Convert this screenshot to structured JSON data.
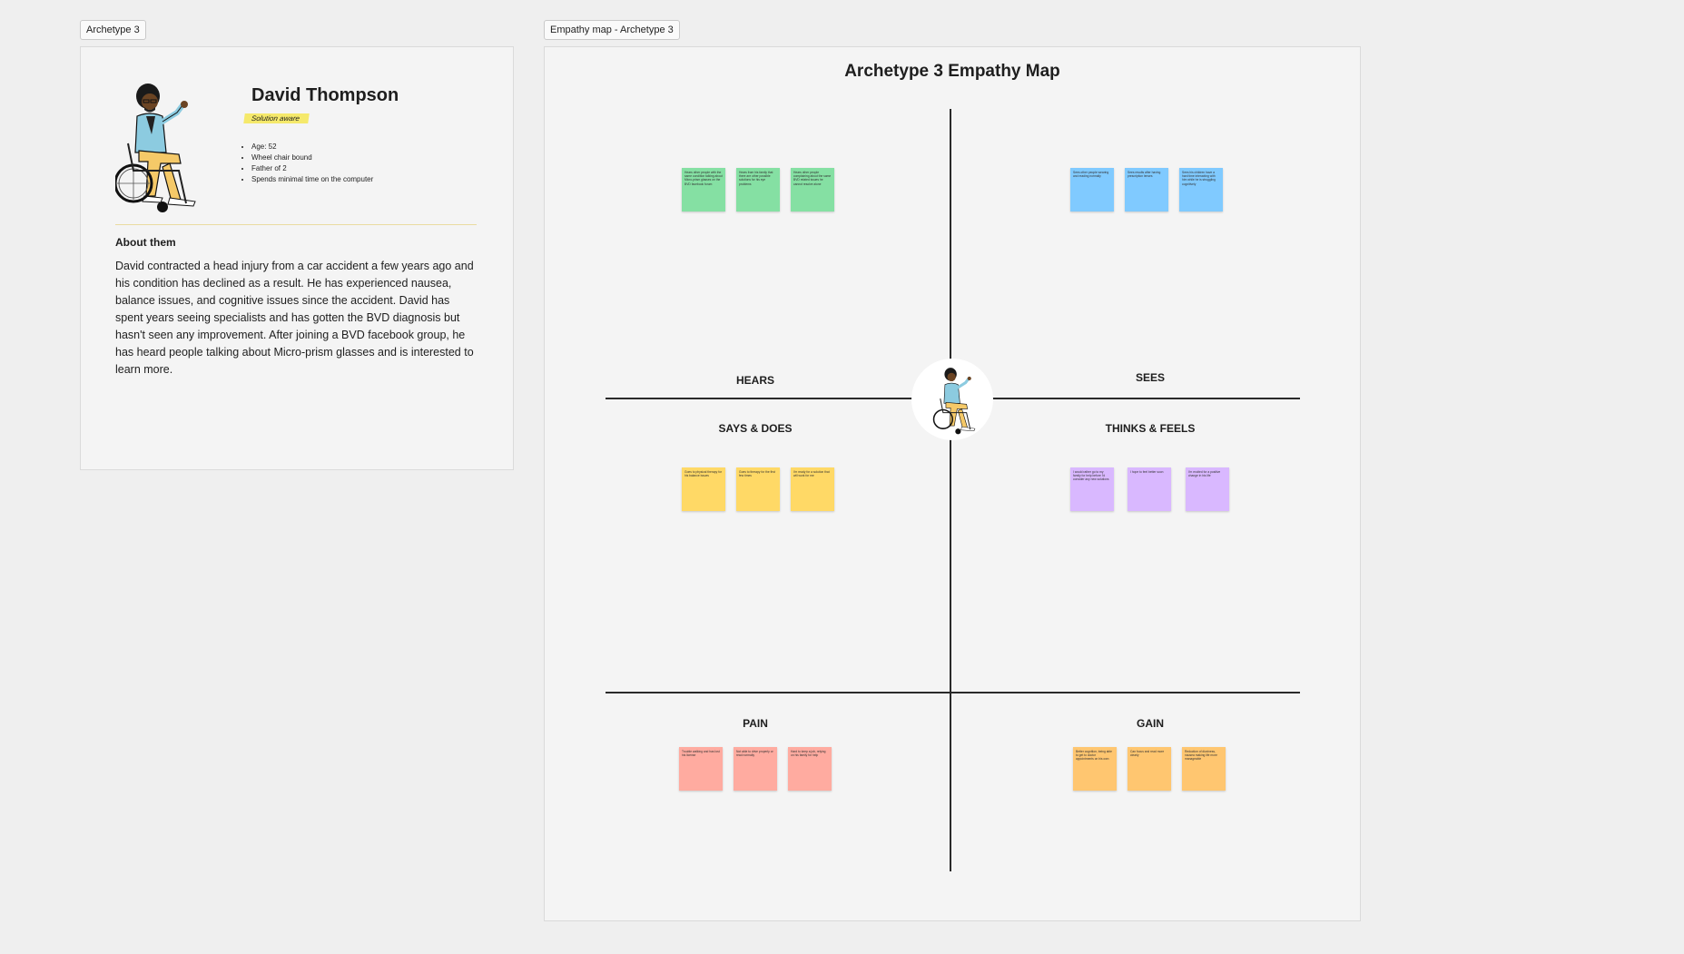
{
  "persona_frame": {
    "label": "Archetype 3",
    "name": "David Thompson",
    "tag": "Solution aware",
    "facts": [
      "Age: 52",
      "Wheel chair bound",
      "Father of 2",
      "Spends minimal time on the computer"
    ],
    "about_heading": "About them",
    "about_body": "David contracted a head injury from a car accident a few years ago and his condition has declined as a result. He has experienced nausea, balance issues, and cognitive issues since the accident. David has spent years seeing specialists and has gotten the BVD diagnosis but hasn't seen any improvement. After joining a BVD facebook group, he has heard people talking about Micro-prism glasses and is interested to learn more.",
    "avatar_icon": "person-in-wheelchair-illustration"
  },
  "map_frame": {
    "label": "Empathy map - Archetype 3",
    "title": "Archetype 3 Empathy Map",
    "quadrants": {
      "hears": "HEARS",
      "sees": "SEES",
      "says_does": "SAYS & DOES",
      "thinks_feels": "THINKS & FEELS",
      "pain": "PAIN",
      "gain": "GAIN"
    },
    "colors": {
      "hears": "#85e0a3",
      "sees": "#80caff",
      "says_does": "#ffd966",
      "thinks_feels": "#d9b8ff",
      "pain": "#ffaba0",
      "gain": "#ffc670"
    },
    "stickies": {
      "hears": [
        "Hears other people with the same condition talking about Micro-prism glasses on the BVD facebook forum",
        "Hears from his family that there are other possible solutions for his eye problems",
        "Hears other people complaining about the same BVD related issues he cannot resolve alone"
      ],
      "sees": [
        "Sees other people wearing and reading normally",
        "Sees results after having prescription lenses",
        "Sees his children have a hard time interacting with him while he is struggling cognitively"
      ],
      "says_does": [
        "Goes to physical therapy for his balance issues",
        "Goes to therapy for the first few times",
        "I'm ready for a solution that will work for me"
      ],
      "thinks_feels": [
        "I would rather go to my family for help before I'd consider any new solutions",
        "I hope to feel better soon",
        "I'm excited for a positive change in his life"
      ],
      "pain": [
        "Trouble walking and has lost his license",
        "Not able to drive properly or read normally",
        "Hard to keep a job, relying on his family for help"
      ],
      "gain": [
        "Better cognition, being able to get to doctor appointments on his own",
        "Can focus and read more clearly",
        "Reduction of dizziness, nausea making life more manageable"
      ]
    }
  }
}
